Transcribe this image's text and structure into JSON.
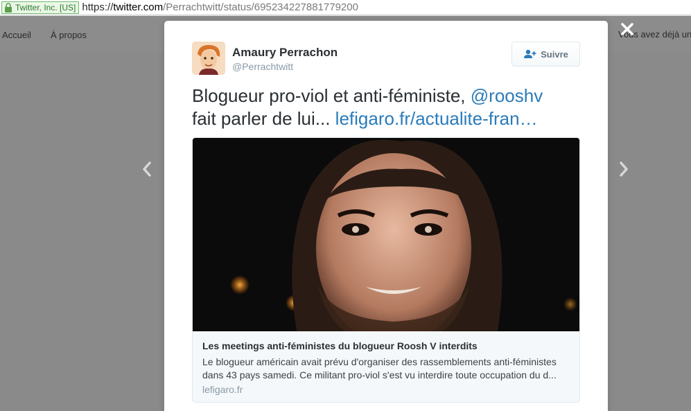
{
  "browser": {
    "secure_label": "Twitter, Inc. [US]",
    "url_scheme": "https://",
    "url_host": "twitter.com",
    "url_path": "/Perrachtwitt/status/695234227881779200"
  },
  "page": {
    "nav": [
      "Accueil",
      "À propos"
    ],
    "already_text": "Vous avez déjà un"
  },
  "tweet": {
    "author_name": "Amaury Perrachon",
    "author_handle": "@Perrachtwitt",
    "follow_label": "Suivre",
    "text_line1": "Blogueur pro-viol et anti-féministe,",
    "mention": "@rooshv",
    "text_line2": "fait parler de lui...",
    "link": "lefigaro.fr/actualite-fran…",
    "card": {
      "title": "Les meetings anti-féministes du blogueur Roosh V interdits",
      "description": "Le blogueur américain avait prévu d'organiser des rassemblements anti-féministes dans 43 pays samedi. Ce militant pro-viol s'est vu interdire toute occupation du d...",
      "domain": "lefigaro.fr"
    }
  },
  "colors": {
    "link": "#2b7bb9",
    "overlay": "#8a8a8a",
    "secure": "#2c7a2c"
  },
  "icons": [
    "lock-icon",
    "close-icon",
    "chevron-left-icon",
    "chevron-right-icon",
    "follow-icon"
  ]
}
